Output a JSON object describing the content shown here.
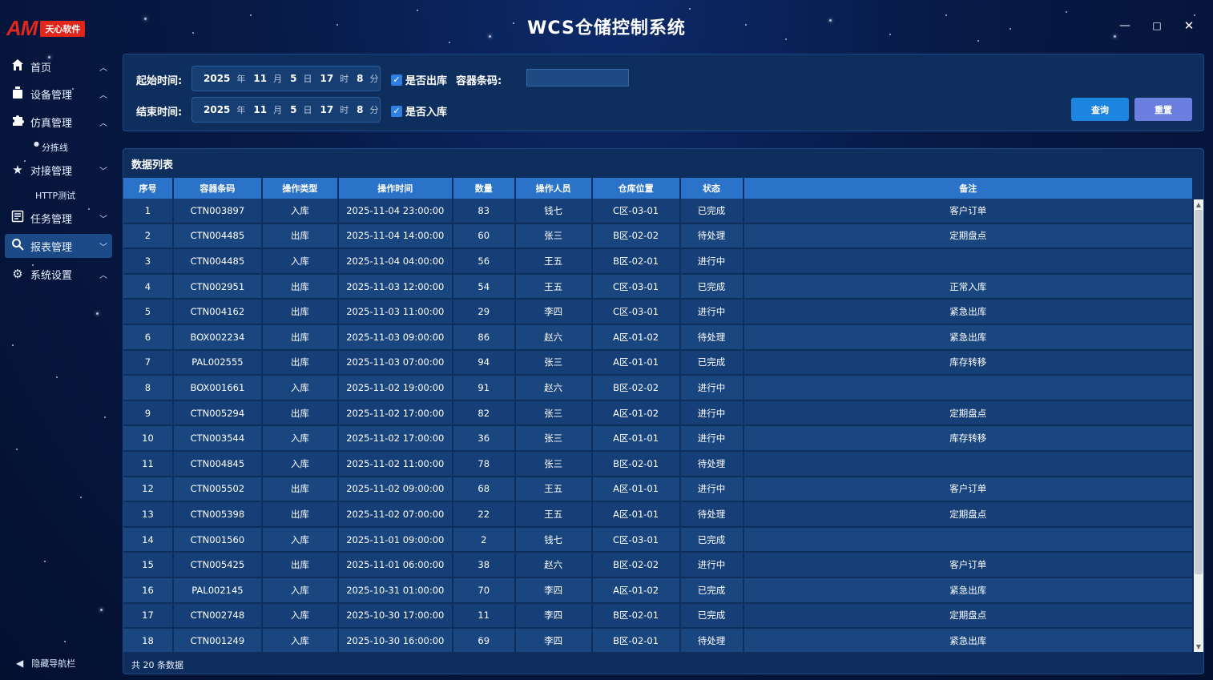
{
  "app": {
    "logo_text": "AM",
    "logo_tag": "天心软件",
    "title": "WCS仓储控制系统",
    "win_min": "—",
    "win_max": "□",
    "win_close": "✕"
  },
  "sidebar": {
    "items": [
      {
        "label": "首页",
        "icon": "home-icon",
        "chevron": "︿"
      },
      {
        "label": "设备管理",
        "icon": "device-icon",
        "chevron": "︿"
      },
      {
        "label": "仿真管理",
        "icon": "puzzle-icon",
        "chevron": "︿"
      },
      {
        "label": "对接管理",
        "icon": "star-icon",
        "chevron": "﹀"
      },
      {
        "label": "任务管理",
        "icon": "task-icon",
        "chevron": "﹀"
      },
      {
        "label": "报表管理",
        "icon": "search-icon",
        "chevron": "﹀"
      },
      {
        "label": "系统设置",
        "icon": "gear-icon",
        "chevron": "︿"
      }
    ],
    "sub_sorting": "分拣线",
    "sub_http": "HTTP测试",
    "hide_nav": "隐藏导航栏"
  },
  "filter": {
    "start_label": "起始时间:",
    "end_label": "结束时间:",
    "start": {
      "year": "2025",
      "month": "11",
      "day": "5",
      "hour": "17",
      "minute": "8"
    },
    "end": {
      "year": "2025",
      "month": "11",
      "day": "5",
      "hour": "17",
      "minute": "8"
    },
    "units": {
      "year": "年",
      "month": "月",
      "day": "日",
      "hour": "时",
      "minute": "分"
    },
    "outbound_label": "是否出库",
    "inbound_label": "是否入库",
    "code_label": "容器条码:",
    "code_value": "",
    "query_label": "查询",
    "reset_label": "重置"
  },
  "list": {
    "title": "数据列表",
    "columns": [
      "序号",
      "容器条码",
      "操作类型",
      "操作时间",
      "数量",
      "操作人员",
      "仓库位置",
      "状态",
      "备注"
    ],
    "rows": [
      [
        "1",
        "CTN003897",
        "入库",
        "2025-11-04 23:00:00",
        "83",
        "钱七",
        "C区-03-01",
        "已完成",
        "客户订单"
      ],
      [
        "2",
        "CTN004485",
        "出库",
        "2025-11-04 14:00:00",
        "60",
        "张三",
        "B区-02-02",
        "待处理",
        "定期盘点"
      ],
      [
        "3",
        "CTN004485",
        "入库",
        "2025-11-04 04:00:00",
        "56",
        "王五",
        "B区-02-01",
        "进行中",
        ""
      ],
      [
        "4",
        "CTN002951",
        "出库",
        "2025-11-03 12:00:00",
        "54",
        "王五",
        "C区-03-01",
        "已完成",
        "正常入库"
      ],
      [
        "5",
        "CTN004162",
        "出库",
        "2025-11-03 11:00:00",
        "29",
        "李四",
        "C区-03-01",
        "进行中",
        "紧急出库"
      ],
      [
        "6",
        "BOX002234",
        "出库",
        "2025-11-03 09:00:00",
        "86",
        "赵六",
        "A区-01-02",
        "待处理",
        "紧急出库"
      ],
      [
        "7",
        "PAL002555",
        "出库",
        "2025-11-03 07:00:00",
        "94",
        "张三",
        "A区-01-01",
        "已完成",
        "库存转移"
      ],
      [
        "8",
        "BOX001661",
        "入库",
        "2025-11-02 19:00:00",
        "91",
        "赵六",
        "B区-02-02",
        "进行中",
        ""
      ],
      [
        "9",
        "CTN005294",
        "出库",
        "2025-11-02 17:00:00",
        "82",
        "张三",
        "A区-01-02",
        "进行中",
        "定期盘点"
      ],
      [
        "10",
        "CTN003544",
        "入库",
        "2025-11-02 17:00:00",
        "36",
        "张三",
        "A区-01-01",
        "进行中",
        "库存转移"
      ],
      [
        "11",
        "CTN004845",
        "入库",
        "2025-11-02 11:00:00",
        "78",
        "张三",
        "B区-02-01",
        "待处理",
        ""
      ],
      [
        "12",
        "CTN005502",
        "出库",
        "2025-11-02 09:00:00",
        "68",
        "王五",
        "A区-01-01",
        "进行中",
        "客户订单"
      ],
      [
        "13",
        "CTN005398",
        "出库",
        "2025-11-02 07:00:00",
        "22",
        "王五",
        "A区-01-01",
        "待处理",
        "定期盘点"
      ],
      [
        "14",
        "CTN001560",
        "入库",
        "2025-11-01 09:00:00",
        "2",
        "钱七",
        "C区-03-01",
        "已完成",
        ""
      ],
      [
        "15",
        "CTN005425",
        "出库",
        "2025-11-01 06:00:00",
        "38",
        "赵六",
        "B区-02-02",
        "进行中",
        "客户订单"
      ],
      [
        "16",
        "PAL002145",
        "入库",
        "2025-10-31 01:00:00",
        "70",
        "李四",
        "A区-01-02",
        "已完成",
        "紧急出库"
      ],
      [
        "17",
        "CTN002748",
        "入库",
        "2025-10-30 17:00:00",
        "11",
        "李四",
        "B区-02-01",
        "已完成",
        "定期盘点"
      ],
      [
        "18",
        "CTN001249",
        "入库",
        "2025-10-30 16:00:00",
        "69",
        "李四",
        "B区-02-01",
        "待处理",
        "紧急出库"
      ]
    ],
    "total_text": "共 20 条数据"
  },
  "colors": {
    "accent": "#2a73c8",
    "logo_red": "#e1261c",
    "query_button": "#1c85e0",
    "reset_button": "#6b7fe0"
  }
}
